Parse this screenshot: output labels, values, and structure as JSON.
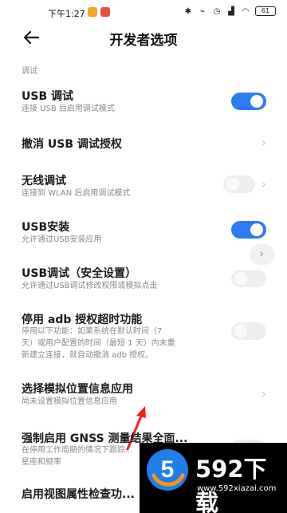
{
  "status_bar": {
    "time": "下午1:27",
    "battery": "61"
  },
  "header": {
    "title": "开发者选项"
  },
  "section": {
    "label": "调试"
  },
  "items": [
    {
      "title": "USB 调试",
      "subtitle": "连接 USB 后启用调试模式",
      "control": "toggle",
      "state": "on"
    },
    {
      "title": "撤消 USB 调试授权",
      "subtitle": "",
      "control": "chevron"
    },
    {
      "title": "无线调试",
      "subtitle": "连接到 WLAN 后启用调试模式",
      "control": "toggle+chevron",
      "state": "off"
    },
    {
      "title": "USB安装",
      "subtitle": "允许通过USB安装应用",
      "control": "toggle",
      "state": "on"
    },
    {
      "title": "USB调试（安全设置）",
      "subtitle": "允许通过USB调试修改权限或模拟点击",
      "control": "toggle",
      "state": "off"
    },
    {
      "title": "停用 adb 授权超时功能",
      "subtitle_lines": [
        "停用以下功能：如果系统在默认时间（7",
        "天）或用户配置的时间（最短 1 天）内未重",
        "新建立连接，就自动撤消 adb 授权。"
      ],
      "control": "toggle",
      "state": "off"
    },
    {
      "title": "选择模拟位置信息应用",
      "subtitle": "尚未设置模拟位置信息应用",
      "control": "chevron"
    },
    {
      "title": "强制启用 GNSS 测量结果全面...",
      "subtitle_lines": [
        "在停用工作周期的情况下跟踪...",
        "星座和频率"
      ],
      "control": "toggle",
      "state": "off"
    },
    {
      "title": "启用视图属性检查功...",
      "subtitle": "",
      "control": "none"
    }
  ],
  "watermark": {
    "brand": "592下载",
    "url": "www.592xiazai.com",
    "logo_digit": "5"
  },
  "colors": {
    "toggle_on": "#2d7bf4",
    "toggle_off": "#eeeeee",
    "annotation_arrow": "#e8231c"
  }
}
